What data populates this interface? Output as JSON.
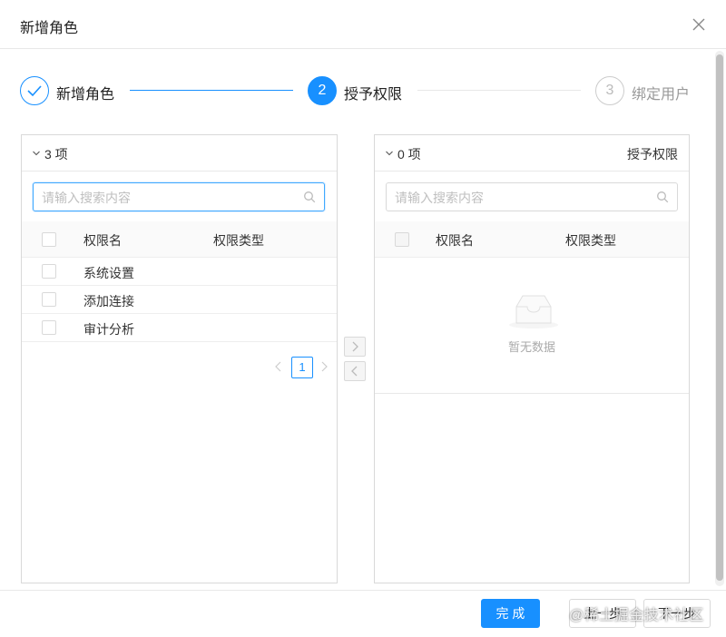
{
  "modal": {
    "title": "新增角色",
    "close_icon": "close-icon"
  },
  "steps": [
    {
      "number": "1",
      "label": "新增角色",
      "status": "finished",
      "icon": "check-icon"
    },
    {
      "number": "2",
      "label": "授予权限",
      "status": "current"
    },
    {
      "number": "3",
      "label": "绑定用户",
      "status": "waiting"
    }
  ],
  "transfer": {
    "left": {
      "count": "3 项",
      "search_placeholder": "请输入搜索内容",
      "columns": [
        "权限名",
        "权限类型"
      ],
      "rows": [
        {
          "name": "系统设置",
          "type": ""
        },
        {
          "name": "添加连接",
          "type": ""
        },
        {
          "name": "审计分析",
          "type": ""
        }
      ],
      "page": "1"
    },
    "right": {
      "count": "0 项",
      "title": "授予权限",
      "search_placeholder": "请输入搜索内容",
      "columns": [
        "权限名",
        "权限类型"
      ],
      "empty_text": "暂无数据"
    },
    "move_right_icon": "chevron-right-icon",
    "move_left_icon": "chevron-left-icon"
  },
  "footer": {
    "finish_label": "完 成",
    "prev_label": "上一步",
    "next_label": "下一步"
  },
  "watermark": "@稀土掘金技术社区",
  "colors": {
    "primary": "#1890ff",
    "border": "#d9d9d9",
    "muted_text": "#aaaaaa"
  }
}
